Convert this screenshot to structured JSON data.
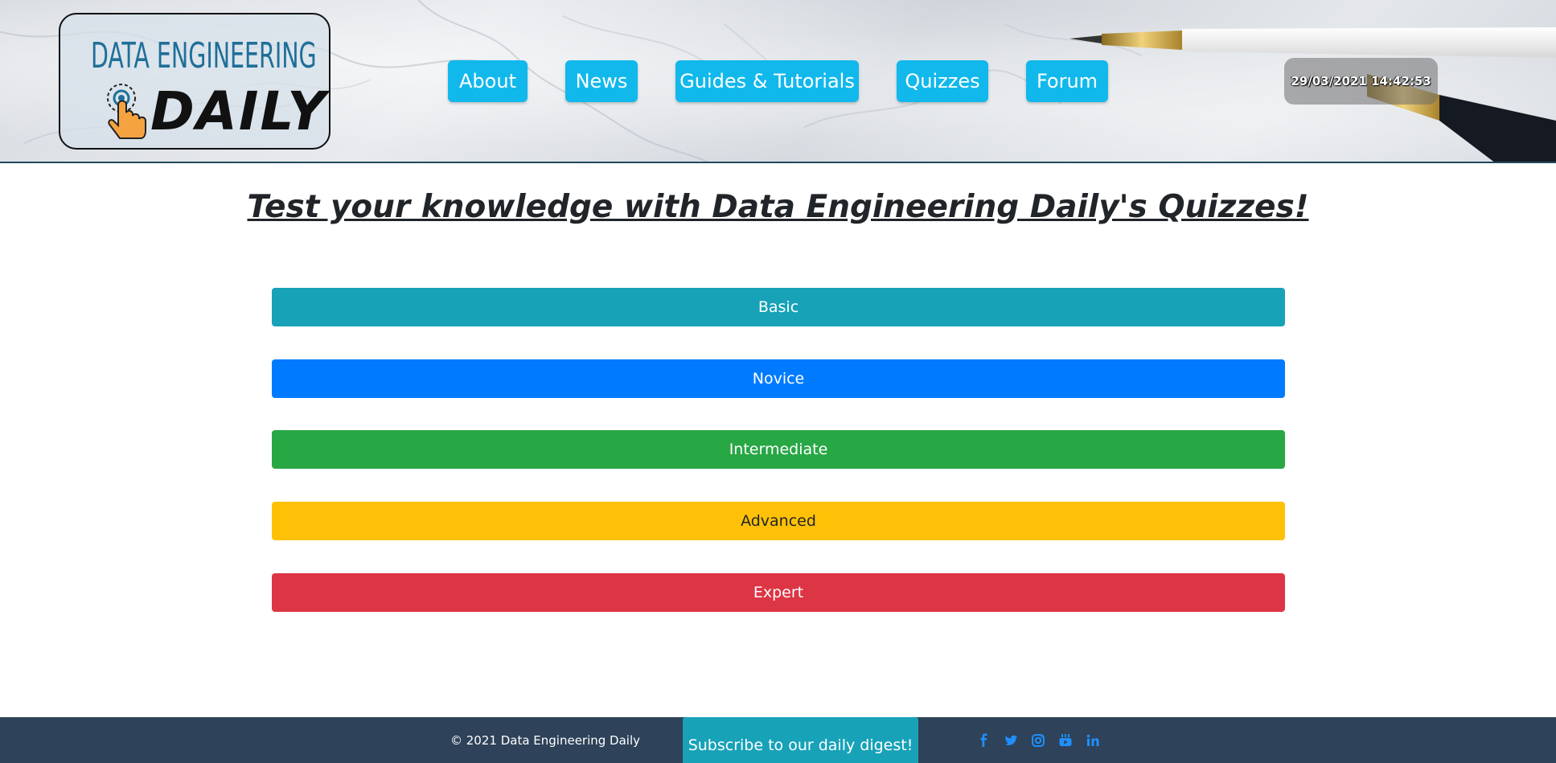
{
  "header": {
    "logo": {
      "line1": "DATA ENGINEERING",
      "line2": "DAILY"
    },
    "nav": [
      {
        "label": "About"
      },
      {
        "label": "News"
      },
      {
        "label": "Guides & Tutorials"
      },
      {
        "label": "Quizzes"
      },
      {
        "label": "Forum"
      }
    ],
    "clock": "29/03/2021 14:42:53"
  },
  "main": {
    "title": "Test your knowledge with Data Engineering Daily's Quizzes!",
    "levels": [
      {
        "label": "Basic",
        "color": "#17a2b8"
      },
      {
        "label": "Novice",
        "color": "#007bff"
      },
      {
        "label": "Intermediate",
        "color": "#28a745"
      },
      {
        "label": "Advanced",
        "color": "#ffc107"
      },
      {
        "label": "Expert",
        "color": "#dc3545"
      }
    ]
  },
  "footer": {
    "copyright": "© 2021 Data Engineering Daily",
    "subscribe_label": "Subscribe to our daily digest!",
    "social": [
      {
        "icon": "facebook-icon"
      },
      {
        "icon": "twitter-icon"
      },
      {
        "icon": "instagram-icon"
      },
      {
        "icon": "youtube-icon"
      },
      {
        "icon": "linkedin-icon"
      }
    ],
    "social_color": "#1e90ff"
  },
  "colors": {
    "nav_accent": "#11b8ec",
    "footer_bg": "#2e4259"
  }
}
